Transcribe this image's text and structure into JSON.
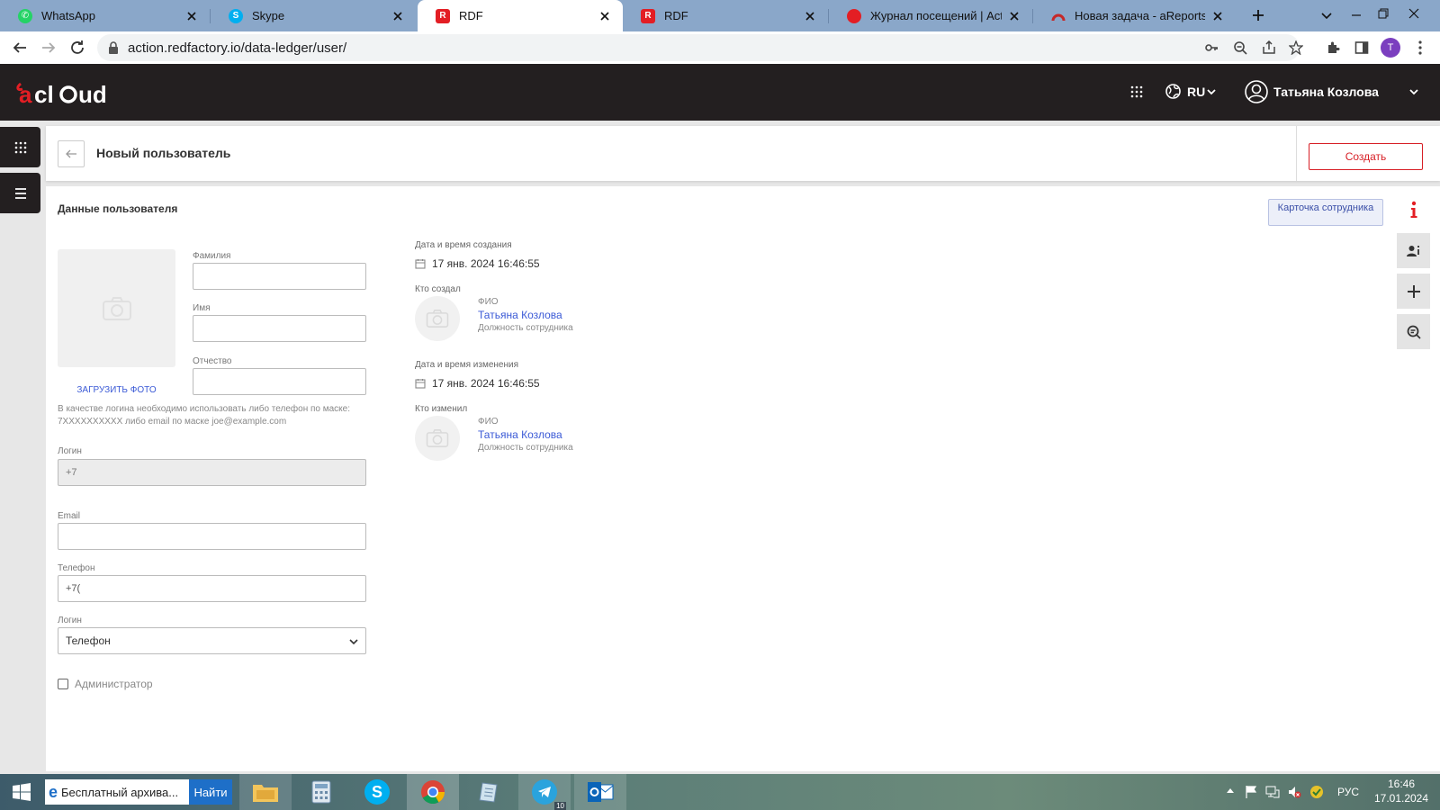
{
  "browser": {
    "tabs": [
      {
        "title": "WhatsApp",
        "color": "#25d366"
      },
      {
        "title": "Skype",
        "color": "#00aff0"
      },
      {
        "title": "RDF",
        "color": "#e31e24"
      },
      {
        "title": "RDF",
        "color": "#e31e24"
      },
      {
        "title": "Журнал посещений | Action R",
        "color": "#e31e24"
      },
      {
        "title": "Новая задача - aReports - SU",
        "color": "#c62828"
      }
    ],
    "active_tab_index": 2,
    "url": "action.redfactory.io/data-ledger/user/",
    "profile_initial": "T"
  },
  "site": {
    "logo_text": "acloud",
    "brand_color": "#e31e24",
    "lang": "RU",
    "user_name": "Татьяна Козлова"
  },
  "page": {
    "title": "Новый пользователь",
    "create_label": "Создать",
    "section_title": "Данные пользователя",
    "employee_card_label": "Карточка сотрудника"
  },
  "form": {
    "upload_photo": "ЗАГРУЗИТЬ ФОТО",
    "surname_label": "Фамилия",
    "name_label": "Имя",
    "patronymic_label": "Отчество",
    "login_hint": "В качестве логина необходимо использовать либо телефон по маске: 7XXXXXXXXXX либо email по маске joe@example.com",
    "login_label": "Логин",
    "login_value": "+7",
    "email_label": "Email",
    "phone_label": "Телефон",
    "phone_value": "+7(",
    "login_type_label": "Логин",
    "login_type_value": "Телефон",
    "admin_label": "Администратор"
  },
  "meta": {
    "created_at_label": "Дата и время создания",
    "created_at": "17 янв. 2024 16:46:55",
    "created_by_label": "Кто создал",
    "fio_label": "ФИО",
    "created_by_name": "Татьяна Козлова",
    "position": "Должность сотрудника",
    "modified_at_label": "Дата и время изменения",
    "modified_at": "17 янв. 2024 16:46:55",
    "modified_by_label": "Кто изменил",
    "modified_by_name": "Татьяна Козлова"
  },
  "taskbar": {
    "search_text": "Бесплатный архива...",
    "search_button": "Найти",
    "lang": "РУС",
    "time": "16:46",
    "date": "17.01.2024",
    "telegram_badge": "10"
  }
}
